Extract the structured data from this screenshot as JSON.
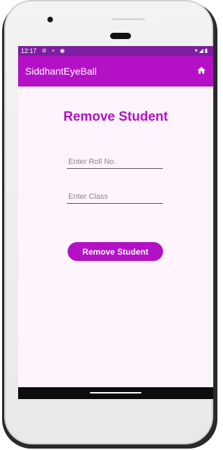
{
  "status_bar": {
    "time": "12:17",
    "left_icons": "⊘ ▪ ◉",
    "right_icons": "▾◢▮"
  },
  "app_bar": {
    "title": "SiddhantEyeBall",
    "home_icon": "home-icon"
  },
  "page": {
    "title": "Remove Student"
  },
  "form": {
    "roll_placeholder": "Enter Roll No.",
    "class_placeholder": "Enter Class",
    "submit_label": "Remove Student"
  },
  "colors": {
    "accent": "#b410c6",
    "status_bar": "#7c1fa0",
    "background": "#fdf4fe"
  }
}
